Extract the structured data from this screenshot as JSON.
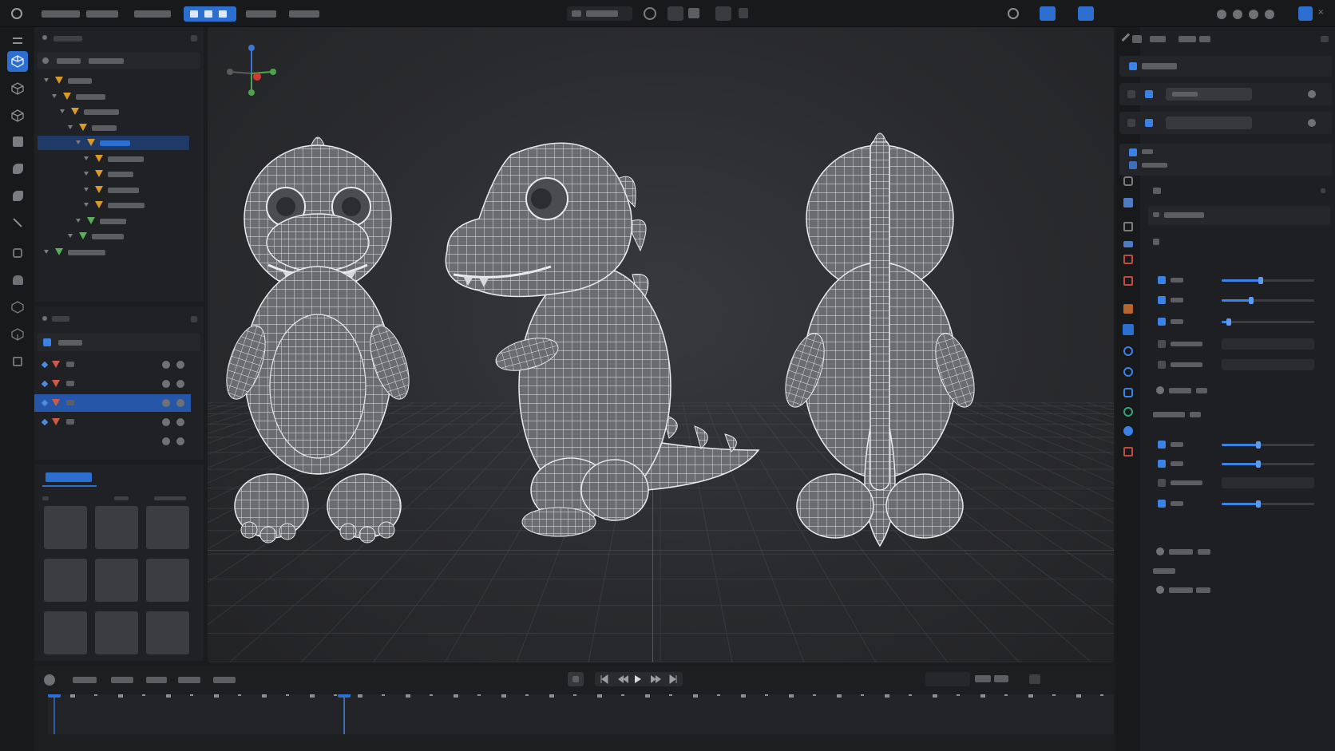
{
  "app": {
    "accent": "#2d6fd1",
    "viewport_bg": "#2c2d30"
  },
  "topbar": {
    "menus": [
      "",
      "",
      "",
      ""
    ],
    "workspace_tabs": [
      "",
      "",
      ""
    ],
    "icons": [
      "transform-icon",
      "snap-icon",
      "proportional-icon",
      "overlay-icon",
      "shading-icon"
    ]
  },
  "toolbar": {
    "tools": [
      "select-box-icon",
      "cursor-icon",
      "move-icon",
      "rotate-icon",
      "scale-icon",
      "transform-icon",
      "measure-icon",
      "annotate-icon",
      "add-cube-icon",
      "extrude-icon",
      "inset-icon"
    ]
  },
  "outliner": {
    "rows": [
      {
        "depth": 0,
        "color": "orange"
      },
      {
        "depth": 1,
        "color": "orange"
      },
      {
        "depth": 2,
        "color": "orange"
      },
      {
        "depth": 3,
        "color": "orange"
      },
      {
        "depth": 4,
        "color": "orange",
        "selected": true
      },
      {
        "depth": 5,
        "color": "orange"
      },
      {
        "depth": 5,
        "color": "orange"
      },
      {
        "depth": 5,
        "color": "orange"
      },
      {
        "depth": 5,
        "color": "orange"
      },
      {
        "depth": 4,
        "color": "green"
      },
      {
        "depth": 3,
        "color": "green"
      },
      {
        "depth": 0,
        "color": "green"
      }
    ]
  },
  "layers": {
    "rows": [
      {
        "selected": false
      },
      {
        "selected": false
      },
      {
        "selected": true
      },
      {
        "selected": false
      }
    ]
  },
  "assets": {
    "tab": "",
    "thumbs": 9
  },
  "viewport": {
    "gizmo_axes": [
      "x-axis",
      "y-axis",
      "z-axis"
    ],
    "models": [
      "front-view",
      "side-view",
      "back-view"
    ]
  },
  "properties": {
    "sliders": [
      0.42,
      0.32,
      0.08,
      0.4,
      0.4,
      0.4
    ]
  },
  "timeline": {
    "playback": [
      "jump-start-icon",
      "prev-key-icon",
      "play-icon",
      "next-key-icon",
      "jump-end-icon"
    ],
    "playhead_fraction": 0.278
  }
}
